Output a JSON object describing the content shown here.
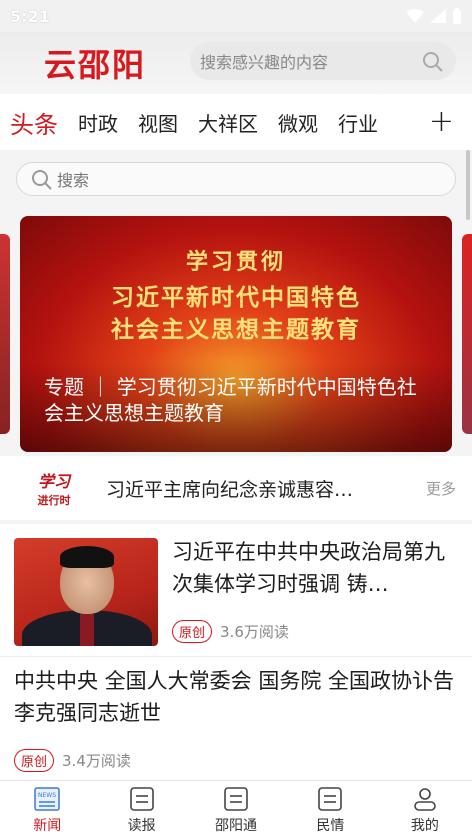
{
  "status": {
    "time": "5:21"
  },
  "header": {
    "logo": "云邵阳",
    "search_placeholder": "搜索感兴趣的内容"
  },
  "tabs": [
    "头条",
    "时政",
    "视图",
    "大祥区",
    "微观",
    "行业"
  ],
  "tab_plus": "+",
  "inner_search": {
    "placeholder": "搜索"
  },
  "banner": {
    "line1": "学习贯彻",
    "line2": "习近平新时代中国特色",
    "line3": "社会主义思想主题教育",
    "caption": "专题 ｜ 学习贯彻习近平新时代中国特色社会主义思想主题教育"
  },
  "strip": {
    "logo_line1": "学习",
    "logo_line2": "进行时",
    "text": "习近平主席向纪念亲诚惠容…",
    "more": "更多"
  },
  "articles": [
    {
      "title": "习近平在中共中央政治局第九次集体学习时强调 铸…",
      "badge": "原创",
      "reads": "3.6万阅读"
    },
    {
      "title": "中共中央 全国人大常委会 国务院 全国政协讣告 李克强同志逝世",
      "badge": "原创",
      "reads": "3.4万阅读"
    }
  ],
  "nav": [
    "新闻",
    "读报",
    "邵阳通",
    "民情",
    "我的"
  ],
  "colors": {
    "accent": "#d7181d"
  }
}
